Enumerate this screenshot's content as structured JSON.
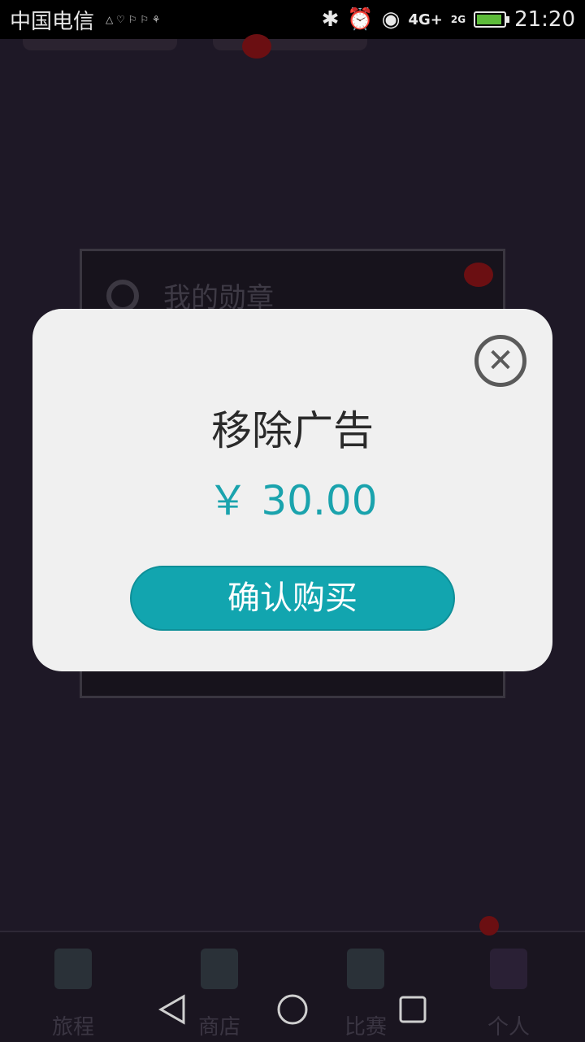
{
  "status_bar": {
    "carrier": "中国电信",
    "network_4g": "4G+",
    "network_2g": "2G",
    "time": "21:20"
  },
  "background": {
    "badge_label": "我的勋章"
  },
  "bottom_nav": {
    "items": [
      {
        "label": "旅程"
      },
      {
        "label": "商店"
      },
      {
        "label": "比赛"
      },
      {
        "label": "个人"
      }
    ]
  },
  "dialog": {
    "title": "移除广告",
    "price": "￥ 30.00",
    "confirm_label": "确认购买"
  },
  "colors": {
    "accent": "#12a5af",
    "dialog_bg": "#f0f0f0",
    "overlay_bg": "#1e1826"
  }
}
